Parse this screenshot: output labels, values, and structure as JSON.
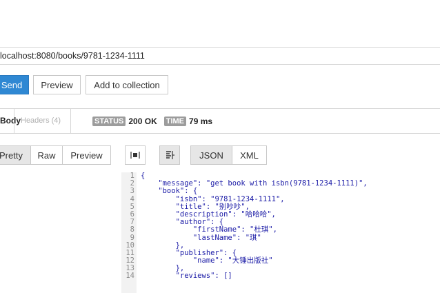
{
  "url_bar": {
    "value": "localhost:8080/books/9781-1234-1111"
  },
  "actions": {
    "send": "Send",
    "preview": "Preview",
    "add_to_collection": "Add to collection"
  },
  "response_tabs": {
    "body": "Body",
    "headers": "Headers (4)",
    "status_label": "STATUS",
    "status_value": "200 OK",
    "time_label": "TIME",
    "time_value": "79 ms"
  },
  "view_modes": {
    "pretty": "Pretty",
    "raw": "Raw",
    "preview": "Preview",
    "json": "JSON",
    "xml": "XML",
    "selected_mode": "Pretty",
    "selected_format": "JSON"
  },
  "icons": {
    "wrap": "wrap-text-icon",
    "format": "indent-format-icon"
  },
  "colors": {
    "send_button": "#2f88d3",
    "status_pill": "#9c9c9c",
    "json_text": "#1a1aa6"
  },
  "code": {
    "line_numbers": [
      "1",
      "2",
      "3",
      "4",
      "5",
      "6",
      "7",
      "8",
      "9",
      "10",
      "11",
      "12",
      "13",
      "14"
    ],
    "lines": [
      "{",
      "    \"message\": \"get book with isbn(9781-1234-1111)\",",
      "    \"book\": {",
      "        \"isbn\": \"9781-1234-1111\",",
      "        \"title\": \"别吵吵\",",
      "        \"description\": \"哈哈哈\",",
      "        \"author\": {",
      "            \"firstName\": \"杜琪\",",
      "            \"lastName\": \"琪\"",
      "        },",
      "        \"publisher\": {",
      "            \"name\": \"大锤出版社\"",
      "        },",
      "        \"reviews\": []"
    ]
  }
}
